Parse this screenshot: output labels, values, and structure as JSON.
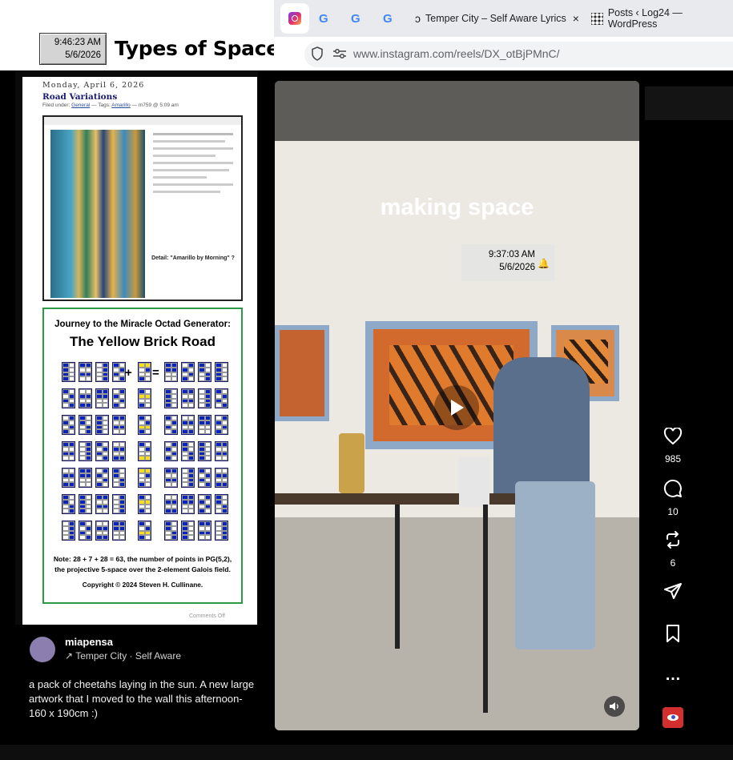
{
  "overlay": {
    "clock_time": "9:46:23 AM",
    "clock_date": "5/6/2026",
    "title": "Types of Space"
  },
  "browser": {
    "tabs": [
      {
        "label": "",
        "icon": "instagram-icon"
      },
      {
        "label": "",
        "icon": "google-icon"
      },
      {
        "label": "",
        "icon": "google-icon"
      },
      {
        "label": "",
        "icon": "google-icon"
      },
      {
        "label": "Temper City – Self Aware Lyrics",
        "icon": "genius-icon"
      },
      {
        "label": "Posts ‹ Log24 — WordPress",
        "icon": "wordpress-icon"
      }
    ],
    "tab_close": "×",
    "url": "www.instagram.com/reels/DX_otBjPMnC/"
  },
  "blog": {
    "date": "Monday, April 6, 2026",
    "post_title": "Road Variations",
    "filed_label": "Filed under:",
    "filed_category": "General",
    "tags_label": "— Tags:",
    "tag": "Amarillo",
    "author_time": "— m759 @ 5:09 am",
    "screenshot_caption": "Detail: \"Amarillo by Morning\" ?",
    "comments_off": "Comments Off"
  },
  "yellow_brick": {
    "heading": "Journey to the Miracle Octad Generator:",
    "title": "The Yellow Brick Road",
    "plus": "+",
    "equals": "=",
    "note_line1": "Note: 28 + 7 + 28 = 63, the number of points in PG(5,2),",
    "note_line2": "the projective 5-space over the 2-element Galois field.",
    "copyright": "Copyright © 2024 Steven H. Cullinane."
  },
  "reel": {
    "caption": "making space",
    "clock_time": "9:37:03 AM",
    "clock_date": "5/6/2026",
    "likes": "985",
    "comments": "10",
    "reposts": "6",
    "more": "…"
  },
  "author": {
    "username": "miapensa",
    "audio": "Temper City · Self Aware",
    "description": "a pack of cheetahs laying in the sun. A new large artwork that I moved to the wall this afternoon- 160 x 190cm :)"
  },
  "colors": {
    "octad_blue": "#0a23b8",
    "octad_yellow": "#f7e01a",
    "card_border": "#2e9a44",
    "instagram_bg": "#000000"
  }
}
